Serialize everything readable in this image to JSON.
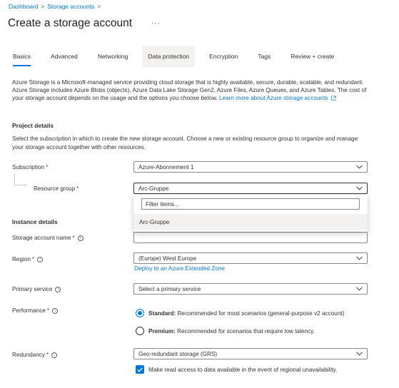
{
  "breadcrumb": {
    "items": [
      "Dashboard",
      "Storage accounts"
    ],
    "separator": ">"
  },
  "page": {
    "title": "Create a storage account",
    "more": "···"
  },
  "tabs": [
    {
      "label": "Basics",
      "active": true
    },
    {
      "label": "Advanced"
    },
    {
      "label": "Networking"
    },
    {
      "label": "Data protection",
      "hovered": true
    },
    {
      "label": "Encryption"
    },
    {
      "label": "Tags"
    },
    {
      "label": "Review + create"
    }
  ],
  "intro": {
    "text": "Azure Storage is a Microsoft-managed service providing cloud storage that is highly available, secure, durable, scalable, and redundant. Azure Storage includes Azure Blobs (objects), Azure Data Lake Storage Gen2, Azure Files, Azure Queues, and Azure Tables. The cost of your storage account depends on the usage and the options you choose below.",
    "link": "Learn more about Azure storage accounts"
  },
  "project": {
    "heading": "Project details",
    "description": "Select the subscription in which to create the new storage account. Choose a new or existing resource group to organize and manage your storage account together with other resources.",
    "subscription_label": "Subscription",
    "subscription_value": "Azure-Abonnement 1",
    "resource_group_label": "Resource group",
    "resource_group_value": "Arc-Gruppe",
    "filter_placeholder": "Filter items...",
    "resource_group_option": "Arc-Gruppe"
  },
  "instance": {
    "heading": "Instance details",
    "name_label": "Storage account name",
    "name_value": "",
    "region_label": "Region",
    "region_value": "(Europe) West Europe",
    "extended_zone_link": "Deploy to an Azure Extended Zone",
    "primary_service_label": "Primary service",
    "primary_service_value": "Select a primary service",
    "performance_label": "Performance",
    "standard_bold": "Standard:",
    "standard_text": "Recommended for most scenarios (general-purpose v2 account)",
    "premium_bold": "Premium:",
    "premium_text": "Recommended for scenarios that require low latency.",
    "redundancy_label": "Redundancy",
    "redundancy_value": "Geo-redundant storage (GRS)",
    "read_access_text": "Make read access to data available in the event of regional unavailability."
  },
  "colors": {
    "accent": "#0078d4",
    "required": "#a4262c",
    "text": "#323130"
  }
}
